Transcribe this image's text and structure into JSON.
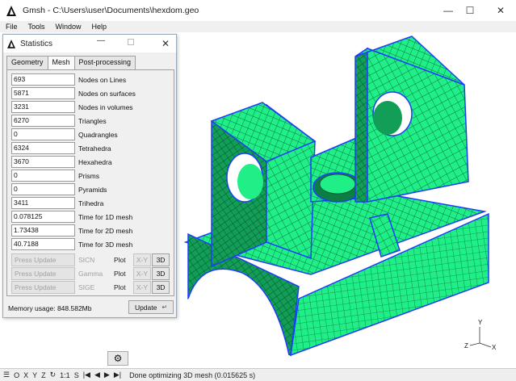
{
  "window": {
    "title": "Gmsh - C:\\Users\\user\\Documents\\hexdom.geo"
  },
  "menu": [
    "File",
    "Tools",
    "Window",
    "Help"
  ],
  "statistics": {
    "title": "Statistics",
    "tabs": [
      "Geometry",
      "Mesh",
      "Post-processing"
    ],
    "rows": [
      {
        "value": "693",
        "label": "Nodes on Lines"
      },
      {
        "value": "5871",
        "label": "Nodes on surfaces"
      },
      {
        "value": "3231",
        "label": "Nodes in volumes"
      },
      {
        "value": "6270",
        "label": "Triangles"
      },
      {
        "value": "0",
        "label": "Quadrangles"
      },
      {
        "value": "6324",
        "label": "Tetrahedra"
      },
      {
        "value": "3670",
        "label": "Hexahedra"
      },
      {
        "value": "0",
        "label": "Prisms"
      },
      {
        "value": "0",
        "label": "Pyramids"
      },
      {
        "value": "3411",
        "label": "Trihedra"
      },
      {
        "value": "0.078125",
        "label": "Time for 1D mesh"
      },
      {
        "value": "1.73438",
        "label": "Time for 2D mesh"
      },
      {
        "value": "40.7188",
        "label": "Time for 3D mesh"
      }
    ],
    "quality_rows": [
      {
        "button": "Press Update",
        "label": "SICN",
        "plot": "Plot",
        "xy": "X-Y",
        "d3": "3D"
      },
      {
        "button": "Press Update",
        "label": "Gamma",
        "plot": "Plot",
        "xy": "X-Y",
        "d3": "3D"
      },
      {
        "button": "Press Update",
        "label": "SIGE",
        "plot": "Plot",
        "xy": "X-Y",
        "d3": "3D"
      }
    ],
    "memory": "Memory usage: 848.582Mb",
    "update_button": "Update"
  },
  "status": {
    "buttons": [
      "O",
      "X",
      "Y",
      "Z",
      "1:1",
      "S"
    ],
    "message": "Done optimizing 3D mesh (0.015625 s)"
  },
  "axes": {
    "y": "Y",
    "z": "Z",
    "x": "X"
  },
  "colors": {
    "mesh_fill": "#1fef86",
    "mesh_edge": "#0a4a30",
    "boundary": "#1e3cff"
  }
}
